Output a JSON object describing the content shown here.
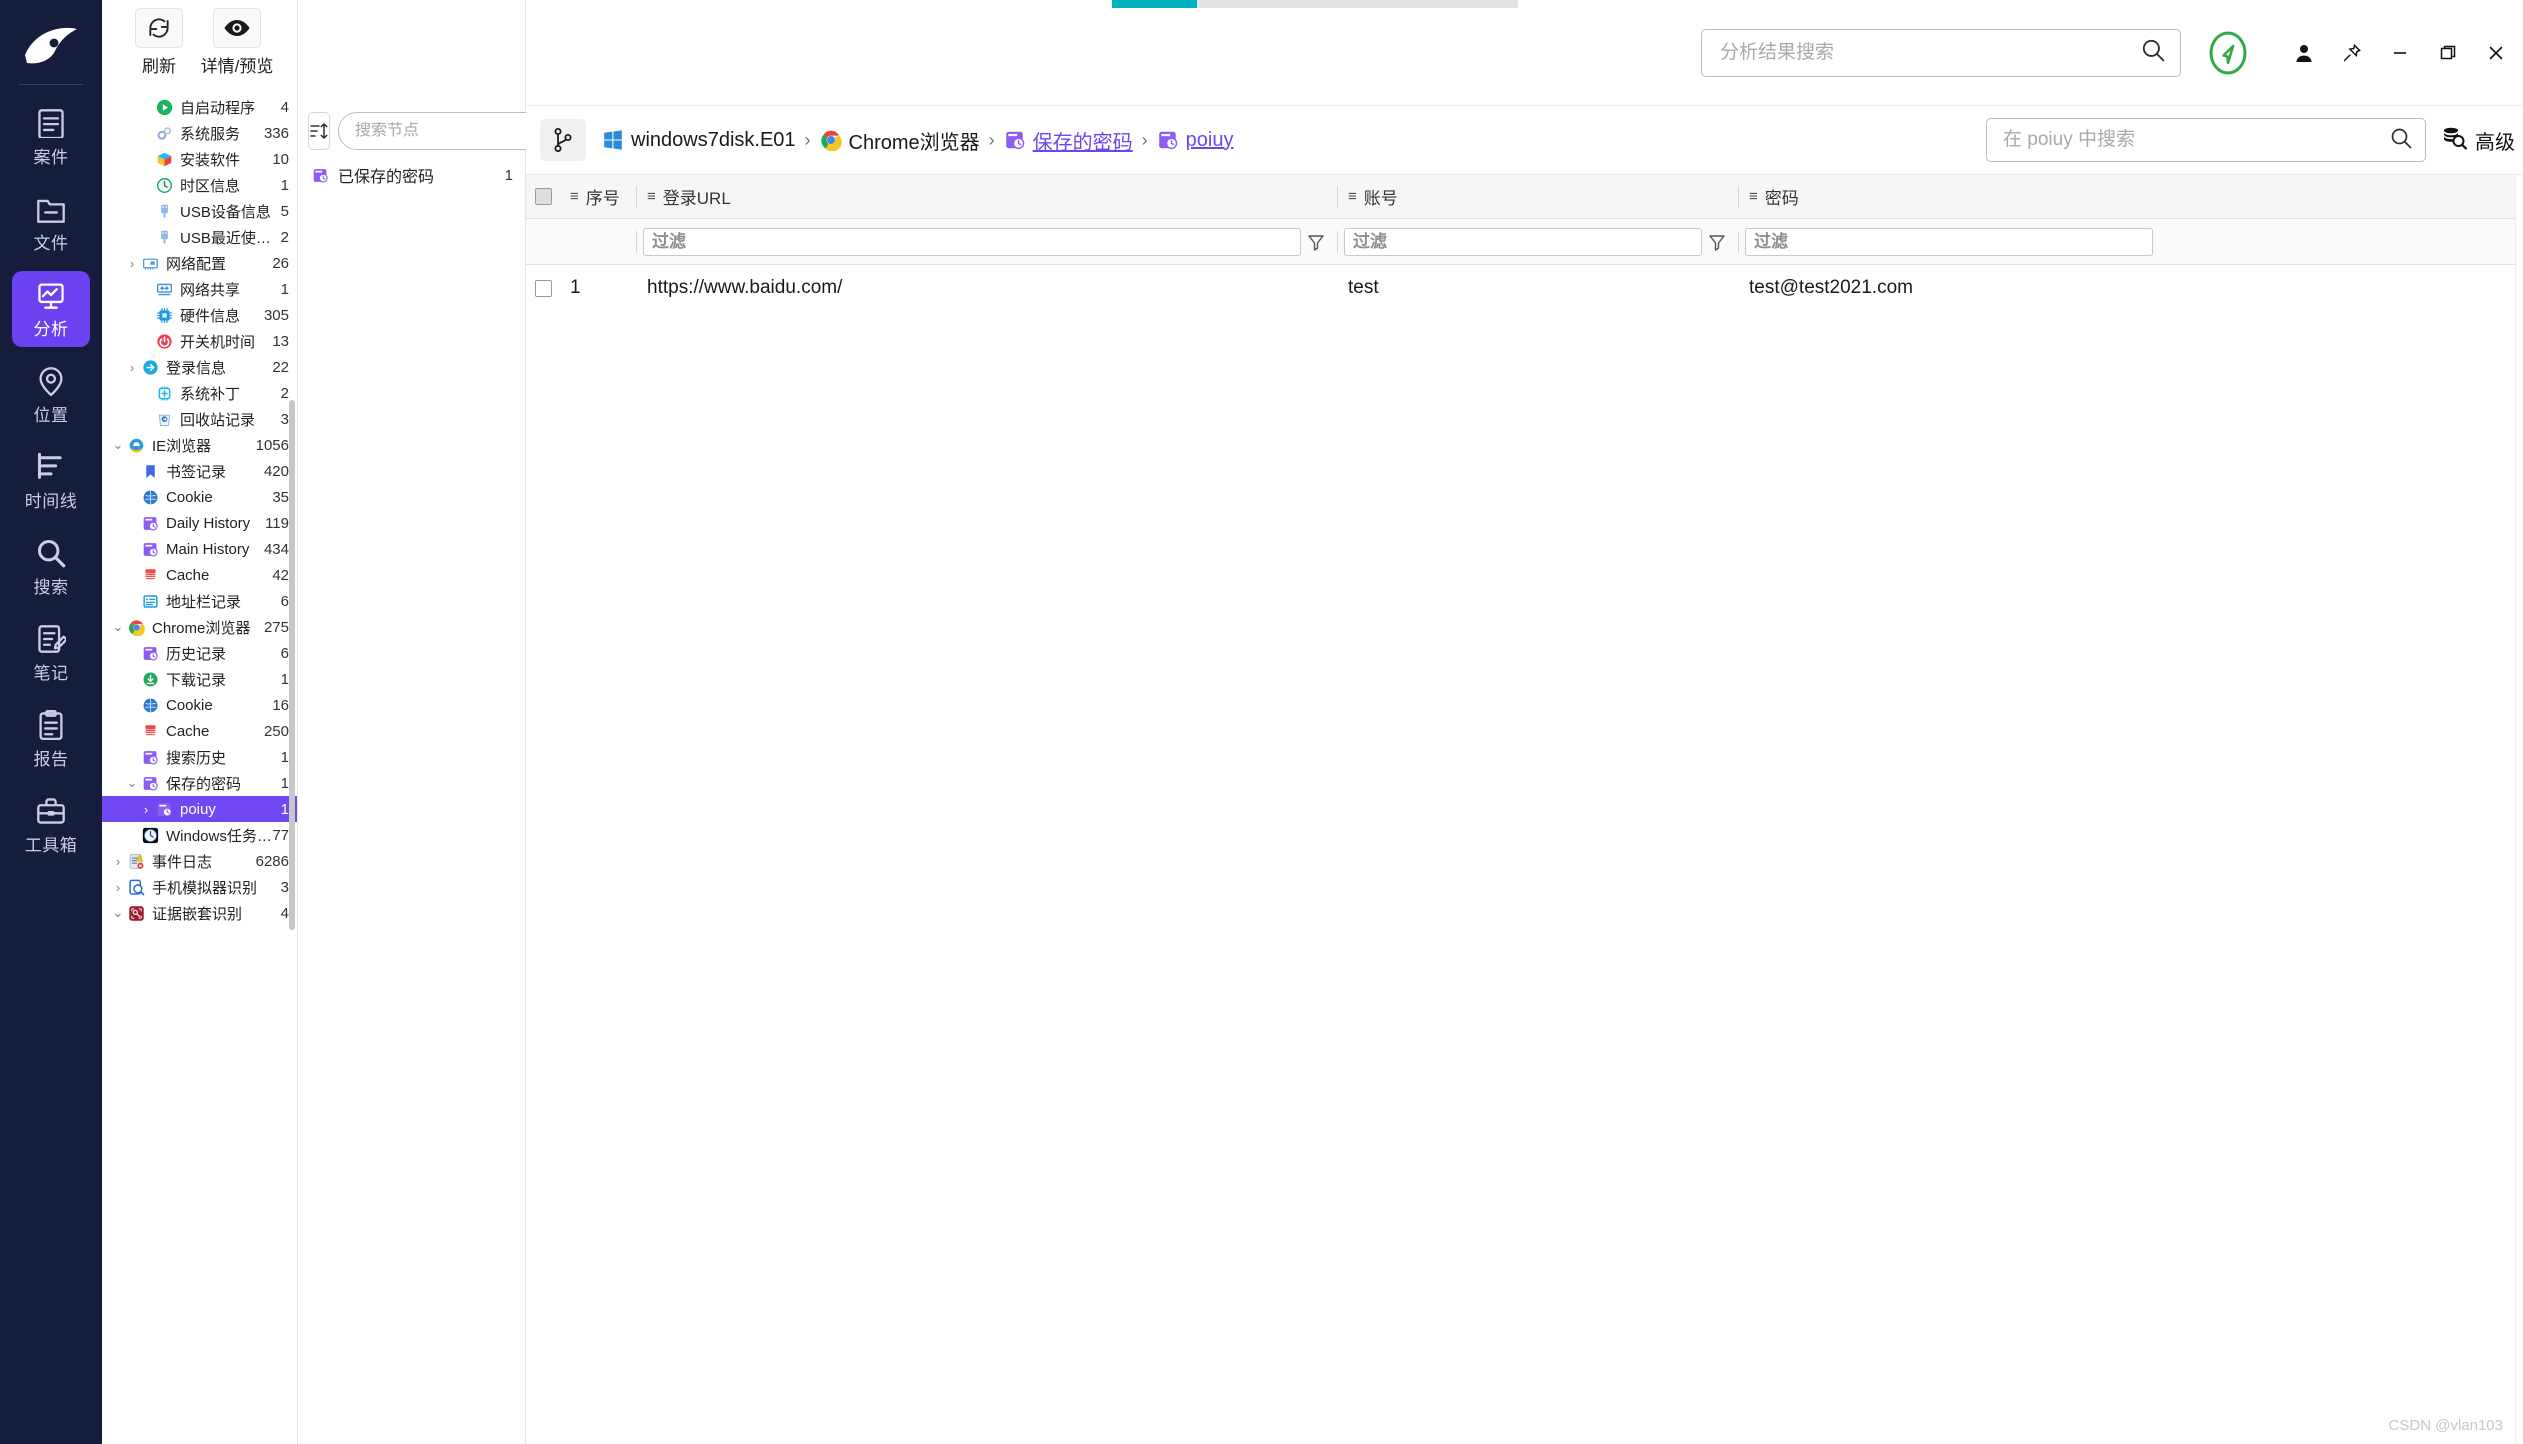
{
  "progress": {
    "percent": 21
  },
  "rail": {
    "logo": "app-logo",
    "items": [
      {
        "label": "案件",
        "icon": "case-icon",
        "active": false
      },
      {
        "label": "文件",
        "icon": "folder-icon",
        "active": false
      },
      {
        "label": "分析",
        "icon": "analysis-icon",
        "active": true
      },
      {
        "label": "位置",
        "icon": "location-icon",
        "active": false
      },
      {
        "label": "时间线",
        "icon": "timeline-icon",
        "active": false
      },
      {
        "label": "搜索",
        "icon": "search-icon",
        "active": false
      },
      {
        "label": "笔记",
        "icon": "note-icon",
        "active": false
      },
      {
        "label": "报告",
        "icon": "report-icon",
        "active": false
      },
      {
        "label": "工具箱",
        "icon": "toolbox-icon",
        "active": false
      }
    ]
  },
  "toolbar": {
    "refresh_label": "刷新",
    "refresh_icon": "refresh-icon",
    "preview_label": "详情/预览",
    "preview_icon": "eye-icon"
  },
  "tree": {
    "items": [
      {
        "label": "自启动程序",
        "count": "4",
        "indent": 2,
        "caret": "",
        "icon": "autostart-icon",
        "selected": false
      },
      {
        "label": "系统服务",
        "count": "336",
        "indent": 2,
        "caret": "",
        "icon": "service-icon",
        "selected": false
      },
      {
        "label": "安装软件",
        "count": "10",
        "indent": 2,
        "caret": "",
        "icon": "software-icon",
        "selected": false
      },
      {
        "label": "时区信息",
        "count": "1",
        "indent": 2,
        "caret": "",
        "icon": "clock-icon",
        "selected": false
      },
      {
        "label": "USB设备信息",
        "count": "5",
        "indent": 2,
        "caret": "",
        "icon": "usb-icon",
        "selected": false
      },
      {
        "label": "USB最近使用记录",
        "count": "2",
        "indent": 2,
        "caret": "",
        "icon": "usb-icon",
        "selected": false
      },
      {
        "label": "网络配置",
        "count": "26",
        "indent": 1,
        "caret": "›",
        "icon": "netcard-icon",
        "selected": false
      },
      {
        "label": "网络共享",
        "count": "1",
        "indent": 2,
        "caret": "",
        "icon": "netshare-icon",
        "selected": false
      },
      {
        "label": "硬件信息",
        "count": "305",
        "indent": 2,
        "caret": "",
        "icon": "chip-icon",
        "selected": false
      },
      {
        "label": "开关机时间",
        "count": "13",
        "indent": 2,
        "caret": "",
        "icon": "power-icon",
        "selected": false
      },
      {
        "label": "登录信息",
        "count": "22",
        "indent": 1,
        "caret": "›",
        "icon": "login-icon",
        "selected": false
      },
      {
        "label": "系统补丁",
        "count": "2",
        "indent": 2,
        "caret": "",
        "icon": "patch-icon",
        "selected": false
      },
      {
        "label": "回收站记录",
        "count": "3",
        "indent": 2,
        "caret": "",
        "icon": "recycle-icon",
        "selected": false
      },
      {
        "label": "IE浏览器",
        "count": "1056",
        "indent": 0,
        "caret": "⌄",
        "icon": "ie-icon",
        "selected": false
      },
      {
        "label": "书签记录",
        "count": "420",
        "indent": 1,
        "caret": "",
        "icon": "bookmark-icon",
        "selected": false
      },
      {
        "label": "Cookie",
        "count": "35",
        "indent": 1,
        "caret": "",
        "icon": "cookie-icon",
        "selected": false
      },
      {
        "label": "Daily History",
        "count": "119",
        "indent": 1,
        "caret": "",
        "icon": "history-icon",
        "selected": false
      },
      {
        "label": "Main History",
        "count": "434",
        "indent": 1,
        "caret": "",
        "icon": "history-icon",
        "selected": false
      },
      {
        "label": "Cache",
        "count": "42",
        "indent": 1,
        "caret": "",
        "icon": "cache-icon",
        "selected": false
      },
      {
        "label": "地址栏记录",
        "count": "6",
        "indent": 1,
        "caret": "",
        "icon": "addressbar-icon",
        "selected": false
      },
      {
        "label": "Chrome浏览器",
        "count": "275",
        "indent": 0,
        "caret": "⌄",
        "icon": "chrome-icon",
        "selected": false
      },
      {
        "label": "历史记录",
        "count": "6",
        "indent": 1,
        "caret": "",
        "icon": "history-icon",
        "selected": false
      },
      {
        "label": "下载记录",
        "count": "1",
        "indent": 1,
        "caret": "",
        "icon": "download-icon",
        "selected": false
      },
      {
        "label": "Cookie",
        "count": "16",
        "indent": 1,
        "caret": "",
        "icon": "cookie-icon",
        "selected": false
      },
      {
        "label": "Cache",
        "count": "250",
        "indent": 1,
        "caret": "",
        "icon": "cache-icon",
        "selected": false
      },
      {
        "label": "搜索历史",
        "count": "1",
        "indent": 1,
        "caret": "",
        "icon": "history-icon",
        "selected": false
      },
      {
        "label": "保存的密码",
        "count": "1",
        "indent": 1,
        "caret": "⌄",
        "icon": "history-icon",
        "selected": false
      },
      {
        "label": "poiuy",
        "count": "1",
        "indent": 2,
        "caret": "›",
        "icon": "history-icon",
        "selected": true
      },
      {
        "label": "Windows任务计划",
        "count": "77",
        "indent": 1,
        "caret": "",
        "icon": "task-icon",
        "selected": false
      },
      {
        "label": "事件日志",
        "count": "6286",
        "indent": 0,
        "caret": "›",
        "icon": "eventlog-icon",
        "selected": false
      },
      {
        "label": "手机模拟器识别",
        "count": "3",
        "indent": 0,
        "caret": "›",
        "icon": "emulator-icon",
        "selected": false
      },
      {
        "label": "证据嵌套识别",
        "count": "4",
        "indent": 0,
        "caret": "⌄",
        "icon": "nested-icon",
        "selected": false
      }
    ]
  },
  "node_panel": {
    "sort_icon": "sort-icon",
    "search_placeholder": "搜索节点",
    "search_value": "",
    "search_icon": "search-icon",
    "items": [
      {
        "label": "已保存的密码",
        "count": "1",
        "icon": "history-icon"
      }
    ]
  },
  "topbar": {
    "search_placeholder": "分析结果搜索",
    "search_value": "",
    "search_icon": "search-icon",
    "send_icon": "send-icon",
    "user_icon": "user-icon",
    "pin_icon": "pin-icon",
    "minimize_icon": "minimize-icon",
    "maximize_icon": "maximize-icon",
    "close_icon": "close-icon"
  },
  "breadcrumb": {
    "branch_icon": "branch-icon",
    "separator": "›",
    "items": [
      {
        "label": "windows7disk.E01",
        "icon": "windows-icon",
        "link": false
      },
      {
        "label": "Chrome浏览器",
        "icon": "chrome-icon",
        "link": false
      },
      {
        "label": "保存的密码",
        "icon": "history-icon",
        "link": true
      },
      {
        "label": "poiuy",
        "icon": "history-icon",
        "link": true
      }
    ],
    "scoped_search_placeholder": "在 poiuy 中搜索",
    "scoped_search_value": "",
    "advanced_label": "高级",
    "advanced_icon": "advanced-search-icon"
  },
  "table": {
    "columns": [
      {
        "key": "index",
        "label": "序号"
      },
      {
        "key": "url",
        "label": "登录URL"
      },
      {
        "key": "acct",
        "label": "账号"
      },
      {
        "key": "pwd",
        "label": "密码"
      }
    ],
    "filter_placeholder": "过滤",
    "filter_values": {
      "url": "",
      "acct": "",
      "pwd": ""
    },
    "rows": [
      {
        "index": "1",
        "url": "https://www.baidu.com/",
        "acct": "test",
        "pwd": "test@test2021.com",
        "checked": false
      }
    ]
  },
  "watermark": {
    "text": "CSDN @vlan103"
  },
  "colors": {
    "rail_bg": "#151c3c",
    "accent": "#7048f2",
    "progress": "#00b0bd",
    "link": "#6b46f0"
  }
}
